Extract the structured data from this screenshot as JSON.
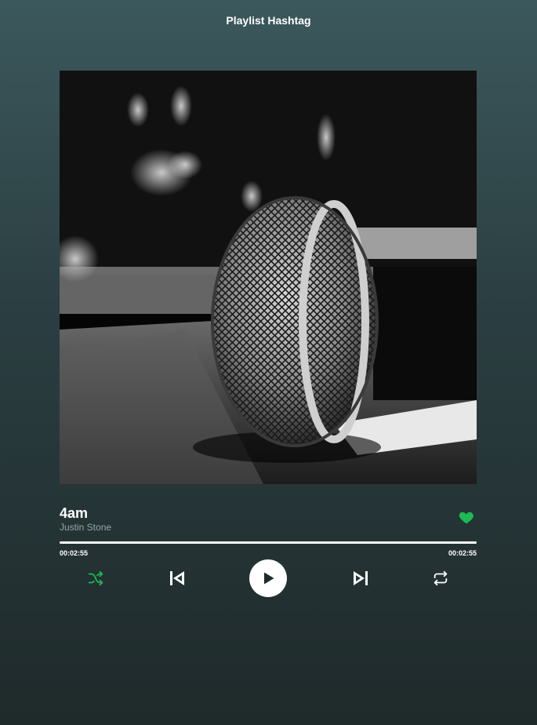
{
  "header": {
    "title": "Playlist Hashtag"
  },
  "album_art": {
    "description_icon": "microphone-photo"
  },
  "track": {
    "title": "4am",
    "artist": "Justin Stone",
    "liked": true
  },
  "playback": {
    "progress_fraction": 1.0,
    "elapsed": "00:02:55",
    "duration": "00:02:55"
  },
  "controls": {
    "shuffle_icon": "shuffle-icon",
    "prev_icon": "skip-back-icon",
    "play_icon": "play-icon",
    "next_icon": "skip-forward-icon",
    "repeat_icon": "repeat-icon"
  },
  "colors": {
    "accent": "#1db954",
    "background_top": "#3b585c",
    "background_bottom": "#1f2a2a",
    "text_primary": "#ffffff",
    "text_secondary": "#9aa4a5"
  }
}
